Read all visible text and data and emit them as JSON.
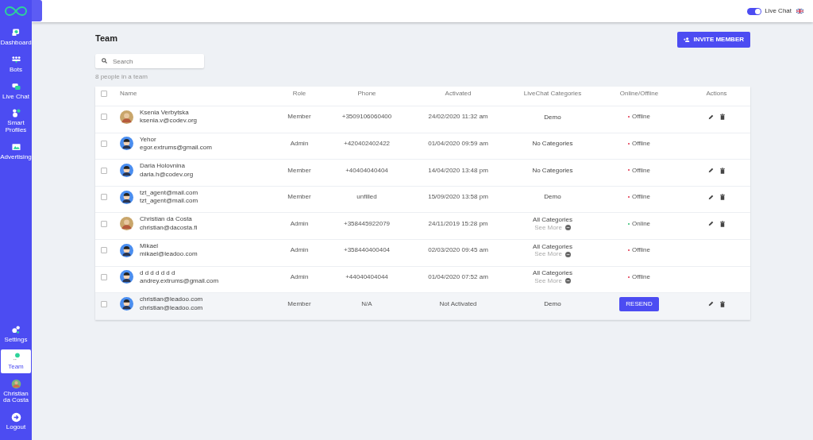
{
  "sidebar": {
    "items": [
      {
        "label": "Dashboard",
        "selected": false
      },
      {
        "label": "Bots",
        "selected": false
      },
      {
        "label": "Live Chat",
        "selected": false
      },
      {
        "label": "Smart Profiles",
        "selected": false
      },
      {
        "label": "Advertising",
        "selected": false
      }
    ],
    "bottom_items": [
      {
        "label": "Settings",
        "selected": false
      },
      {
        "label": "Team",
        "selected": true
      },
      {
        "label": "Christian da Costa",
        "selected": false
      },
      {
        "label": "Logout",
        "selected": false
      }
    ]
  },
  "top_bar": {
    "live_chat": {
      "label": "Live Chat",
      "on": true
    }
  },
  "page": {
    "title": "Team",
    "invite_button": "INVITE MEMBER",
    "search": {
      "placeholder": "Search"
    },
    "count": "8 people in a team"
  },
  "table": {
    "select_all": {
      "checked": false
    },
    "columns": [
      "Name",
      "Role",
      "Phone",
      "Activated",
      "LiveChat Categories",
      "Online/Offline",
      "Actions"
    ],
    "rows": [
      {
        "checked": false,
        "name": "Ksenia Verbytska",
        "email": "ksenia.v@codev.org",
        "role": "Member",
        "phone": "+3509106060400",
        "activated": "24/02/2020 11:32 am",
        "categories": "Demo",
        "see_more": null,
        "status": {
          "kind": "status",
          "text": "Offline",
          "online": false
        },
        "actions": true,
        "pending": false
      },
      {
        "checked": false,
        "name": "Yehor",
        "email": "egor.extrums@gmail.com",
        "role": "Admin",
        "phone": "+420402402422",
        "activated": "01/04/2020 09:59 am",
        "categories": "No Categories",
        "see_more": null,
        "status": {
          "kind": "status",
          "text": "Offline",
          "online": false
        },
        "actions": false,
        "pending": false
      },
      {
        "checked": false,
        "name": "Daria Holovnina",
        "email": "daria.h@codev.org",
        "role": "Member",
        "phone": "+40404040404",
        "activated": "14/04/2020 13:48 pm",
        "categories": "No Categories",
        "see_more": null,
        "status": {
          "kind": "status",
          "text": "Offline",
          "online": false
        },
        "actions": true,
        "pending": false
      },
      {
        "checked": false,
        "name": "tzt_agent@mail.com",
        "email": "tzt_agent@mail.com",
        "role": "Member",
        "phone": "unfilled",
        "activated": "15/09/2020 13:58 pm",
        "categories": "Demo",
        "see_more": null,
        "status": {
          "kind": "status",
          "text": "Offline",
          "online": false
        },
        "actions": true,
        "pending": false
      },
      {
        "checked": false,
        "name": "Christian da Costa",
        "email": "christian@dacosta.fi",
        "role": "Admin",
        "phone": "+358445922079",
        "activated": "24/11/2019 15:28 pm",
        "categories": "All Categories",
        "see_more": "See More",
        "status": {
          "kind": "status",
          "text": "Online",
          "online": true
        },
        "actions": true,
        "pending": false
      },
      {
        "checked": false,
        "name": "Mikael",
        "email": "mikael@leadoo.com",
        "role": "Admin",
        "phone": "+358440400404",
        "activated": "02/03/2020 09:45 am",
        "categories": "All Categories",
        "see_more": "See More",
        "status": {
          "kind": "status",
          "text": "Offline",
          "online": false
        },
        "actions": false,
        "pending": false
      },
      {
        "checked": false,
        "name": "d d d d d d d",
        "email": "andrey.extrums@gmail.com",
        "role": "Admin",
        "phone": "+44040404044",
        "activated": "01/04/2020 07:52 am",
        "categories": "All Categories",
        "see_more": "See More",
        "status": {
          "kind": "status",
          "text": "Offline",
          "online": false
        },
        "actions": false,
        "pending": false
      },
      {
        "checked": false,
        "name": "christian@leadoo.com",
        "email": "christian@leadoo.com",
        "role": "Member",
        "phone": "N/A",
        "activated": "Not Activated",
        "categories": "Demo",
        "see_more": null,
        "status": {
          "kind": "button",
          "text": "RESEND"
        },
        "actions": true,
        "pending": true
      }
    ]
  }
}
